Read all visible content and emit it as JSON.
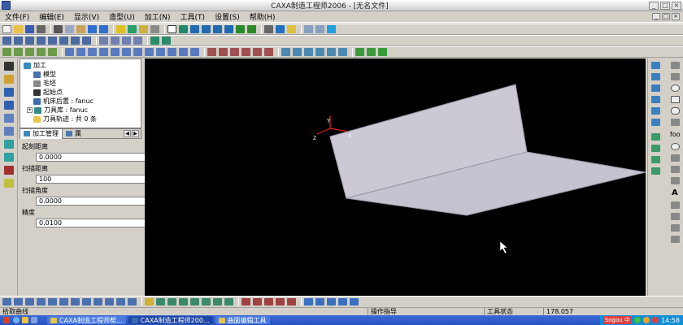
{
  "window": {
    "title": "CAXA制造工程师2006 - [无名文件]",
    "win_buttons": [
      "_",
      "□",
      "×"
    ]
  },
  "menu": [
    "文件(F)",
    "编辑(E)",
    "显示(V)",
    "造型(U)",
    "加工(N)",
    "工具(T)",
    "设置(S)",
    "帮助(H)"
  ],
  "tree": {
    "root": "加工",
    "items": [
      "模型",
      "毛坯",
      "起始点",
      "机床后置 : fanuc",
      "刀具库 : fanuc",
      "刀具轨迹 : 共 0 条"
    ]
  },
  "tabs": {
    "manage": "加工管理",
    "layer": "属"
  },
  "props": [
    {
      "label": "起刻距离",
      "value": "0.0000"
    },
    {
      "label": "扫描距离",
      "value": "100"
    },
    {
      "label": "扫描角度",
      "value": "0.0000"
    },
    {
      "label": "精度",
      "value": "0.0100"
    }
  ],
  "axis_labels": {
    "y": "Y",
    "z": "Z",
    "x": "X"
  },
  "right_text": {
    "foo": "foo",
    "A": "A"
  },
  "status": {
    "prompt": "拾取曲线",
    "hint": "操作指导",
    "tool_state": "工具状态",
    "coord": "178.057"
  },
  "taskbar": {
    "tasks": [
      "CAXA制造工程师帮...",
      "CAXA制造工程师200...",
      "曲面编辑工具"
    ],
    "ime": "Sogou 中",
    "time": "14:58"
  },
  "colors": {
    "viewport": "#000000",
    "face": "#ccc8d4",
    "taskbar": "#2553c4"
  }
}
